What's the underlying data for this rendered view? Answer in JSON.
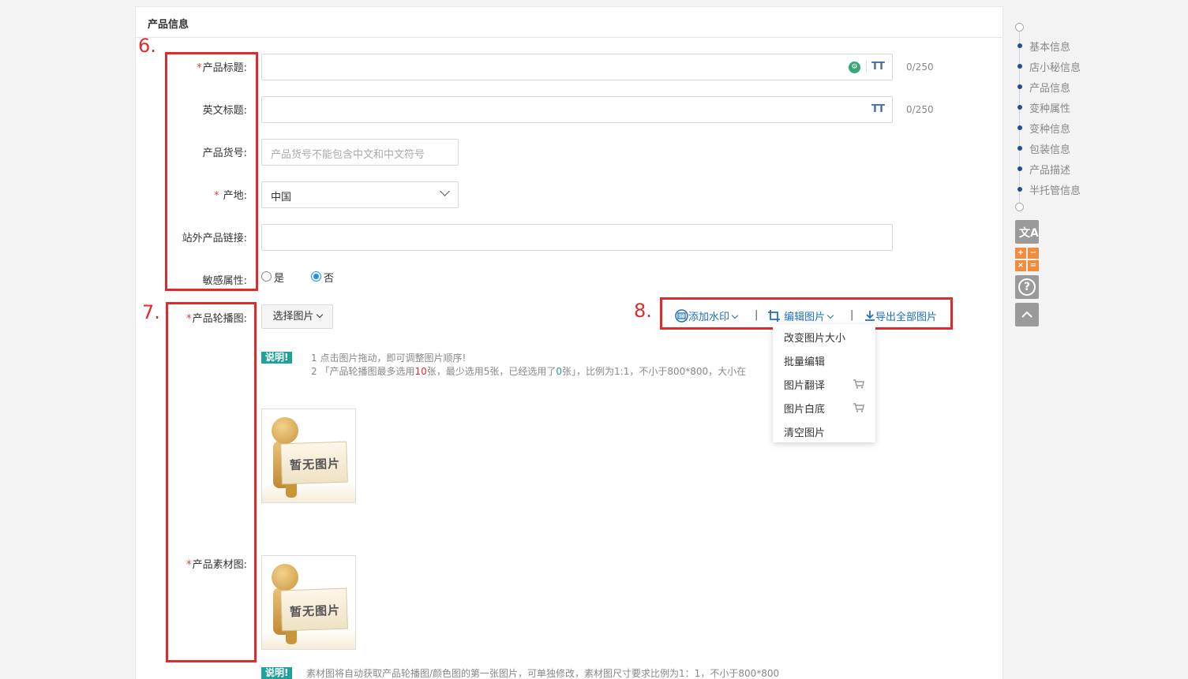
{
  "section": {
    "title": "产品信息"
  },
  "markers": {
    "m6": "6.",
    "m7": "7.",
    "m8": "8."
  },
  "form": {
    "product_title": {
      "label": "产品标题:",
      "count": "0/250",
      "tt": "TT",
      "ai_icon": "chatgpt-icon"
    },
    "english_title": {
      "label": "英文标题:",
      "count": "0/250",
      "tt": "TT"
    },
    "sku": {
      "label": "产品货号:",
      "placeholder": "产品货号不能包含中文和中文符号"
    },
    "origin": {
      "label": "产地:",
      "value": "中国"
    },
    "external_link": {
      "label": "站外产品链接:"
    },
    "sensitive": {
      "label": "敏感属性:",
      "options": [
        "是",
        "否"
      ],
      "selected": "否"
    },
    "carousel": {
      "label": "产品轮播图:",
      "choose_button": "选择图片"
    },
    "material": {
      "label": "产品素材图:"
    },
    "required_mark": "*"
  },
  "image_tools": {
    "watermark": "添加水印",
    "edit": "编辑图片",
    "sep": "|",
    "export": "导出全部图片"
  },
  "edit_menu": {
    "items": [
      "改变图片大小",
      "批量编辑",
      "图片翻译",
      "图片白底",
      "清空图片"
    ]
  },
  "notes": {
    "badge": "说明!",
    "line1": "1 点击图片拖动，即可调整图片顺序!",
    "line2_a": "2 「产品轮播图最多选用",
    "line2_max": "10",
    "line2_b": "张，最少选用5张，已经选用了",
    "line2_used": "0",
    "line2_c": "张」，比例为1:1，不小于800*800，大小在",
    "material_note": "素材图将自动获取产品轮播图/颜色图的第一张图片，可单独修改，素材图尺寸要求比例为1：1，不小于800*800"
  },
  "placeholder_image": {
    "text": "暂无图片"
  },
  "side_nav": {
    "items": [
      "基本信息",
      "店小秘信息",
      "产品信息",
      "变种属性",
      "变种信息",
      "包装信息",
      "产品描述",
      "半托管信息"
    ]
  },
  "side_tools": {
    "translate": "文A",
    "calc": [
      "+",
      "−",
      "×",
      "="
    ],
    "help": "?"
  }
}
